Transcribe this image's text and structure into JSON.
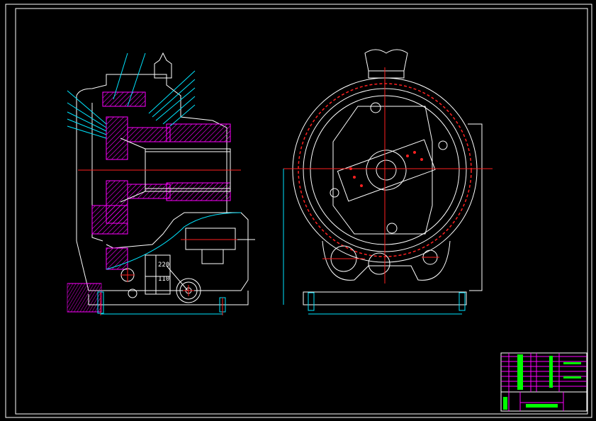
{
  "drawing": {
    "side_view": {
      "labels": {
        "upper": "220",
        "lower": "110"
      }
    },
    "colors": {
      "background": "#000000",
      "outline": "#ffffff",
      "centerline": "#ff2020",
      "dimension": "#00e5ff",
      "section_hatch": "#ff00ff",
      "title_text": "#00ff00"
    }
  }
}
